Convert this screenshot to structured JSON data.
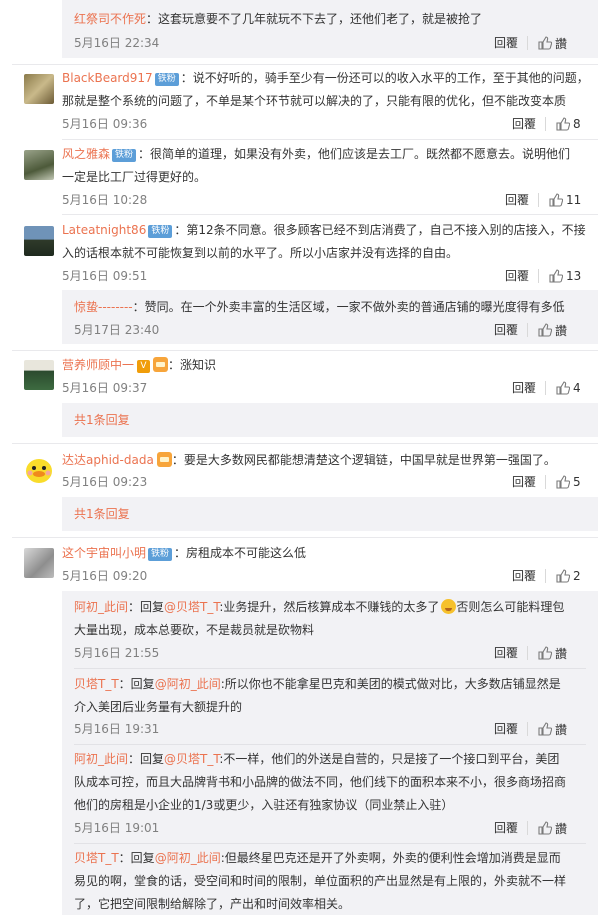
{
  "labels": {
    "reply": "回覆",
    "like": "讚",
    "fan_badge": "铁粉",
    "v_badge": "V"
  },
  "comments": [
    {
      "top_reply": {
        "name": "红祭司不作死",
        "lines": [
          "：这套玩意要不了几年就玩不下去了，还他们老了，就是被抢了"
        ],
        "time": "5月16日 22:34"
      }
    },
    {
      "name": "BlackBeard917",
      "lines": [
        "：说不好听的，骑手至少有一份还可以的收入水平的工作，至于其他的问题，",
        "那就是整个系统的问题了，不单是某个环节就可以解决的了，只能有限的优化，但不能改变本质"
      ],
      "time": "5月16日 09:36",
      "likes": "8"
    },
    {
      "name": "风之雅森",
      "lines": [
        "：很简单的道理，如果没有外卖，他们应该是去工厂。既然都不愿意去。说明他们",
        "一定是比工厂过得更好的。"
      ],
      "time": "5月16日 10:28",
      "likes": "11"
    },
    {
      "name": "Lateatnight86",
      "lines": [
        "：第12条不同意。很多顾客已经不到店消费了，自己不接入别的店接入，不接",
        "入的话根本就不可能恢复到以前的水平了。所以小店家并没有选择的自由。"
      ],
      "time": "5月16日 09:51",
      "likes": "13",
      "reply": {
        "name": "惊蛰--------",
        "lines": [
          "：赞同。在一个外卖丰富的生活区域，一家不做外卖的普通店铺的曝光度得有多低"
        ],
        "time": "5月17日 23:40"
      }
    },
    {
      "name": "营养师顾中一",
      "lines": [
        "：涨知识"
      ],
      "time": "5月16日 09:37",
      "likes": "4",
      "more": "共1条回复"
    },
    {
      "name": "达达aphid-dada",
      "lines": [
        "：要是大多数网民都能想清楚这个逻辑链，中国早就是世界第一强国了。"
      ],
      "time": "5月16日 09:23",
      "likes": "5",
      "more": "共1条回复"
    },
    {
      "name": "这个宇宙叫小明",
      "lines": [
        "：房租成本不可能这么低"
      ],
      "time": "5月16日 09:20",
      "likes": "2",
      "replies": [
        {
          "name": "阿初_此间",
          "mid": "：回复",
          "at": "@贝塔T_T",
          "lines": [
            ":业务提升，然后核算成本不赚钱的太多了",
            "否则怎么可能料理包",
            "大量出现，成本总要砍，不是裁员就是砍物料"
          ],
          "time": "5月16日 21:55"
        },
        {
          "name": "贝塔T_T",
          "mid": "：回复",
          "at": "@阿初_此间",
          "lines": [
            ":所以你也不能拿星巴克和美团的模式做对比，大多数店铺显然是",
            "介入美团后业务量有大额提升的"
          ],
          "time": "5月16日 19:31"
        },
        {
          "name": "阿初_此间",
          "mid": "：回复",
          "at": "@贝塔T_T",
          "lines": [
            ":不一样，他们的外送是自营的，只是接了一个接口到平台，美团",
            "队成本可控，而且大品牌背书和小品牌的做法不同，他们线下的面积本来不小，很多商场招商",
            "他们的房租是小企业的1/3或更少，入驻还有独家协议（同业禁止入驻）"
          ],
          "time": "5月16日 19:01"
        },
        {
          "name": "贝塔T_T",
          "mid": "：回复",
          "at": "@阿初_此间",
          "lines": [
            ":但最终星巴克还是开了外卖啊，外卖的便利性会增加消费是显而",
            "易见的啊，堂食的话，受空间和时间的限制，单位面积的产出显然是有上限的，外卖就不一样",
            "了，它把空间限制给解除了，产出和时间效率相关。"
          ]
        }
      ]
    }
  ]
}
